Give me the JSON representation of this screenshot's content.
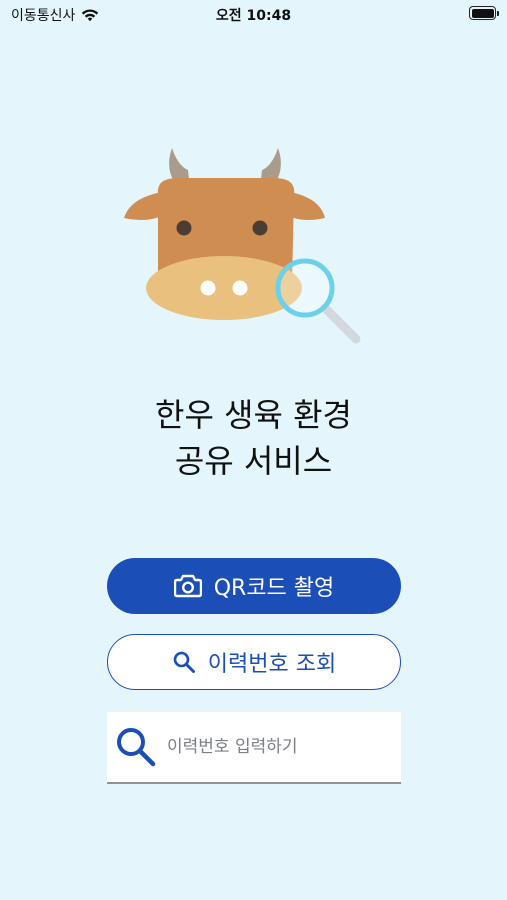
{
  "status_bar": {
    "carrier": "이동통신사",
    "time": "오전 10:48",
    "icons": [
      "wifi-icon",
      "battery-icon"
    ]
  },
  "hero": {
    "illustration": "cow-with-magnifier-icon",
    "title_line1": "한우 생육 환경",
    "title_line2": "공유 서비스"
  },
  "actions": {
    "qr_button_label": "QR코드 촬영",
    "qr_button_icon": "camera-icon",
    "lookup_button_label": "이력번호 조회",
    "lookup_button_icon": "search-icon"
  },
  "search": {
    "placeholder": "이력번호 입력하기",
    "value": "",
    "icon": "search-icon"
  },
  "colors": {
    "background": "#e4f6fc",
    "primary": "#1c4eb8",
    "cow_body": "#d08d51",
    "cow_muzzle": "#e9c07d",
    "magnifier_ring": "#6dd0ea"
  }
}
